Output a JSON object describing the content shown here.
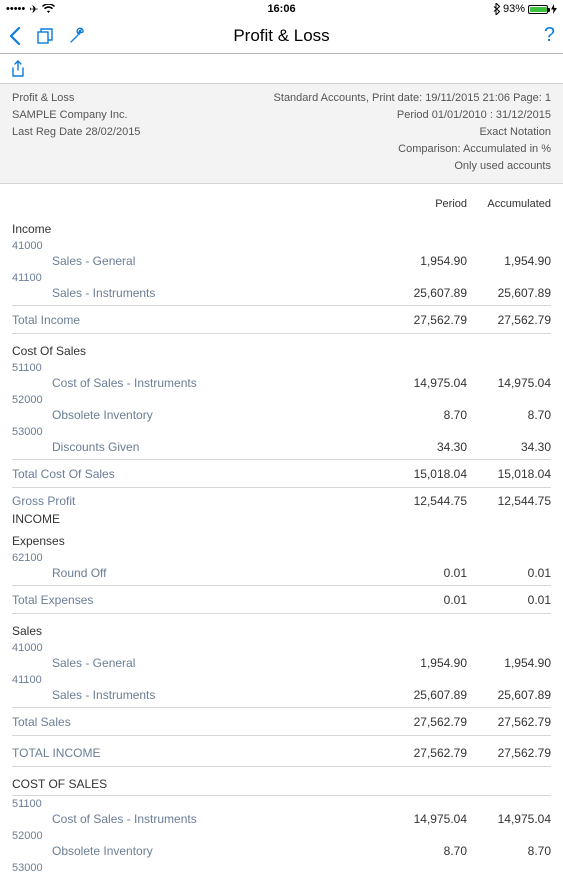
{
  "status": {
    "time": "16:06",
    "battery": "93%"
  },
  "nav": {
    "title": "Profit & Loss",
    "help": "?"
  },
  "header": {
    "left": [
      "Profit & Loss",
      "SAMPLE Company Inc.",
      "Last Reg Date 28/02/2015"
    ],
    "right": [
      "Standard Accounts, Print date: 19/11/2015 21:06 Page: 1",
      "Period 01/01/2010 : 31/12/2015",
      "Exact Notation",
      "Comparison: Accumulated in %",
      "Only used accounts"
    ]
  },
  "columns": {
    "period": "Period",
    "accum": "Accumulated"
  },
  "sections": [
    {
      "title": "Income",
      "rows": [
        {
          "acct": "41000",
          "desc": "Sales - General",
          "period": "1,954.90",
          "accum": "1,954.90"
        },
        {
          "acct": "41100",
          "desc": "Sales - Instruments",
          "period": "25,607.89",
          "accum": "25,607.89"
        }
      ],
      "total": {
        "label": "Total Income",
        "period": "27,562.79",
        "accum": "27,562.79"
      }
    },
    {
      "title": "Cost Of Sales",
      "rows": [
        {
          "acct": "51100",
          "desc": "Cost of Sales - Instruments",
          "period": "14,975.04",
          "accum": "14,975.04"
        },
        {
          "acct": "52000",
          "desc": "Obsolete Inventory",
          "period": "8.70",
          "accum": "8.70"
        },
        {
          "acct": "53000",
          "desc": "Discounts Given",
          "period": "34.30",
          "accum": "34.30"
        }
      ],
      "total": {
        "label": "Total Cost Of Sales",
        "period": "15,018.04",
        "accum": "15,018.04"
      }
    }
  ],
  "gross": {
    "label": "Gross Profit",
    "period": "12,544.75",
    "accum": "12,544.75"
  },
  "incomeCaps": "INCOME",
  "expenses": {
    "title": "Expenses",
    "rows": [
      {
        "acct": "62100",
        "desc": "Round Off",
        "period": "0.01",
        "accum": "0.01"
      }
    ],
    "total": {
      "label": "Total Expenses",
      "period": "0.01",
      "accum": "0.01"
    }
  },
  "sales": {
    "title": "Sales",
    "rows": [
      {
        "acct": "41000",
        "desc": "Sales - General",
        "period": "1,954.90",
        "accum": "1,954.90"
      },
      {
        "acct": "41100",
        "desc": "Sales - Instruments",
        "period": "25,607.89",
        "accum": "25,607.89"
      }
    ],
    "total": {
      "label": "Total Sales",
      "period": "27,562.79",
      "accum": "27,562.79"
    }
  },
  "totalIncome": {
    "label": "TOTAL INCOME",
    "period": "27,562.79",
    "accum": "27,562.79"
  },
  "costOfSalesCaps": "COST OF SALES",
  "cos2": {
    "rows": [
      {
        "acct": "51100",
        "desc": "Cost of Sales - Instruments",
        "period": "14,975.04",
        "accum": "14,975.04"
      },
      {
        "acct": "52000",
        "desc": "Obsolete Inventory",
        "period": "8.70",
        "accum": "8.70"
      }
    ],
    "trailing": "53000"
  }
}
